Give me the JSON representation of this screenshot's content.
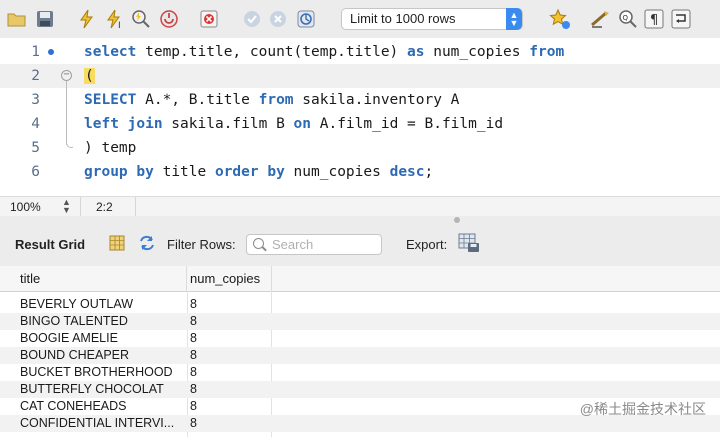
{
  "toolbar": {
    "icons": [
      "open-folder-icon",
      "save-icon",
      "execute-icon",
      "execute-current-icon",
      "explain-icon",
      "stop-icon",
      "toggle-error-icon",
      "commit-icon",
      "rollback-icon",
      "autocommit-icon",
      "bookmark-star-icon",
      "beautify-icon",
      "find-icon",
      "invisible-chars-icon",
      "wrap-icon"
    ],
    "limit_label": "Limit to 1000 rows"
  },
  "editor": {
    "lines": [
      {
        "num": "1"
      },
      {
        "num": "2"
      },
      {
        "num": "3"
      },
      {
        "num": "4"
      },
      {
        "num": "5"
      },
      {
        "num": "6"
      }
    ],
    "tokens": {
      "select": "select",
      "l1_a": " temp.title, count(temp.title) ",
      "as": "as",
      "l1_b": " num_copies ",
      "from": "from",
      "open_paren": "(",
      "SELECT": "SELECT",
      "l3_a": " A.*, B.title ",
      "from2": "from",
      "l3_b": " sakila.inventory A",
      "left": "left",
      "join": "join",
      "l4_a": " sakila.film B ",
      "on": "on",
      "l4_b": " A.film_id = B.film_id",
      "close_paren": ")",
      "l5_b": " temp",
      "group": "group",
      "by": "by",
      "l6_a": " title ",
      "order": "order",
      "by2": "by",
      "l6_b": " num_copies ",
      "desc": "desc",
      "semi": ";"
    }
  },
  "status": {
    "zoom": "100%",
    "cursor": "2:2"
  },
  "result": {
    "label": "Result Grid",
    "filter_label": "Filter Rows:",
    "search_placeholder": "Search",
    "export_label": "Export:"
  },
  "grid": {
    "columns": [
      "title",
      "num_copies"
    ],
    "rows": [
      [
        "BEVERLY OUTLAW",
        "8"
      ],
      [
        "BINGO TALENTED",
        "8"
      ],
      [
        "BOOGIE AMELIE",
        "8"
      ],
      [
        "BOUND CHEAPER",
        "8"
      ],
      [
        "BUCKET BROTHERHOOD",
        "8"
      ],
      [
        "BUTTERFLY CHOCOLAT",
        "8"
      ],
      [
        "CAT CONEHEADS",
        "8"
      ],
      [
        "CONFIDENTIAL INTERVI...",
        "8"
      ]
    ]
  },
  "watermark": "@稀土掘金技术社区"
}
